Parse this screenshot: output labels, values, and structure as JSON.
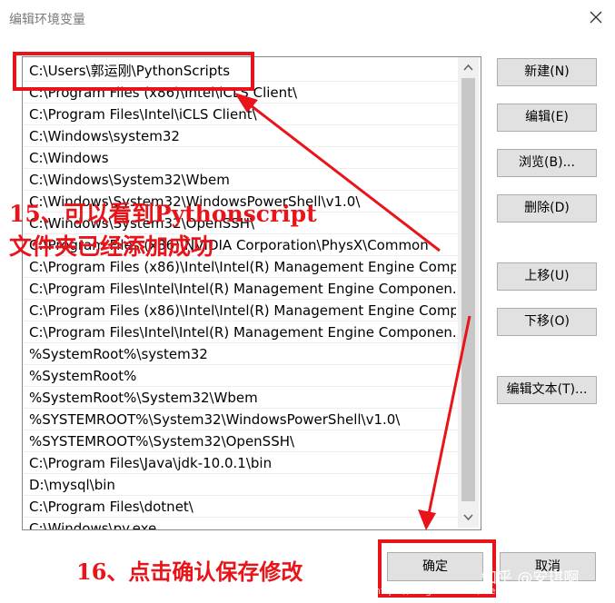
{
  "window": {
    "title": "编辑环境变量"
  },
  "path_list": [
    "C:\\Users\\郭运刚\\PythonScripts",
    "C:\\Program Files (x86)\\Intel\\iCLS Client\\",
    "C:\\Program Files\\Intel\\iCLS Client\\",
    "C:\\Windows\\system32",
    "C:\\Windows",
    "C:\\Windows\\System32\\Wbem",
    "C:\\Windows\\System32\\WindowsPowerShell\\v1.0\\",
    "C:\\Windows\\System32\\OpenSSH\\",
    "C:\\Program Files (x86)\\NVIDIA Corporation\\PhysX\\Common",
    "C:\\Program Files (x86)\\Intel\\Intel(R) Management Engine Comp...",
    "C:\\Program Files\\Intel\\Intel(R) Management Engine Componen...",
    "C:\\Program Files (x86)\\Intel\\Intel(R) Management Engine Comp...",
    "C:\\Program Files\\Intel\\Intel(R) Management Engine Componen...",
    "%SystemRoot%\\system32",
    "%SystemRoot%",
    "%SystemRoot%\\System32\\Wbem",
    "%SYSTEMROOT%\\System32\\WindowsPowerShell\\v1.0\\",
    "%SYSTEMROOT%\\System32\\OpenSSH\\",
    "C:\\Program Files\\Java\\jdk-10.0.1\\bin",
    "D:\\mysql\\bin",
    "C:\\Program Files\\dotnet\\",
    "C:\\Windows\\py.exe"
  ],
  "buttons": {
    "new": "新建(N)",
    "edit": "编辑(E)",
    "browse": "浏览(B)...",
    "delete": "删除(D)",
    "move_up": "上移(U)",
    "move_down": "下移(O)",
    "edit_text": "编辑文本(T)...",
    "ok": "确定",
    "cancel": "取消"
  },
  "annotations": {
    "step15_line1": "15、可以看到Pythonscript",
    "step15_line2": "文件夹已经添加成功",
    "step16": "16、点击确认保存修改"
  },
  "watermark": {
    "zhihu": "知乎 @安琪啊",
    "csdn": "https://blog.csdn.net/weixin_45223930"
  },
  "colors": {
    "annotation_red": "#e8141a",
    "button_bg": "#e1e1e1",
    "scroll_thumb": "#c7c7c7"
  }
}
